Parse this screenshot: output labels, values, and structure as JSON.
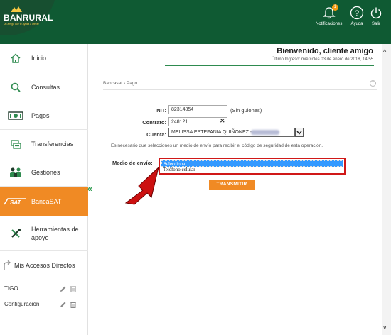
{
  "header": {
    "logo_text": "BANRURAL",
    "logo_tagline": "Un amigo que te ayuda a crecer",
    "notifications_label": "Notificaciones",
    "notifications_count": "1",
    "help_label": "Ayuda",
    "exit_label": "Salir"
  },
  "sidebar": {
    "items": [
      {
        "label": "Inicio",
        "icon": "home-icon"
      },
      {
        "label": "Consultas",
        "icon": "search-icon"
      },
      {
        "label": "Pagos",
        "icon": "cash-icon"
      },
      {
        "label": "Transferencias",
        "icon": "transfer-icon"
      },
      {
        "label": "Gestiones",
        "icon": "gestiones-icon"
      },
      {
        "label": "BancaSAT",
        "icon": "sat-icon"
      },
      {
        "label": "Herramientas de apoyo",
        "icon": "tools-icon"
      }
    ],
    "accesos_label": "Mis Accesos Directos",
    "shortcuts": [
      {
        "label": "TIGO"
      },
      {
        "label": "Configuración"
      }
    ],
    "sat_logo": "SAT"
  },
  "welcome": {
    "title": "Bienvenido, cliente amigo",
    "last_login": "Último Ingreso: miércoles 03 de enero de 2018, 14:55"
  },
  "breadcrumb": "Bancasat › Pago",
  "form": {
    "nit_label": "NIT:",
    "nit_value": "82314854",
    "nit_hint": "(Sin guiones)",
    "contrato_label": "Contrato:",
    "contrato_value": "248121",
    "cuenta_label": "Cuenta:",
    "cuenta_value": "MELISSA ESTEFANIA QUIÑONEZ -",
    "info_text": "Es necesario que selecciones un medio de envío para recibir el código de seguridad de esta operación.",
    "medio_label": "Medio de envío:",
    "medio_options": [
      "Selecciona...",
      "Teléfono celular"
    ],
    "submit_label": "TRANSMITIR"
  },
  "colors": {
    "header_green": "#0f5a33",
    "accent_orange": "#f08a24",
    "highlight_red": "#d01818",
    "selection_blue": "#3399ff"
  }
}
